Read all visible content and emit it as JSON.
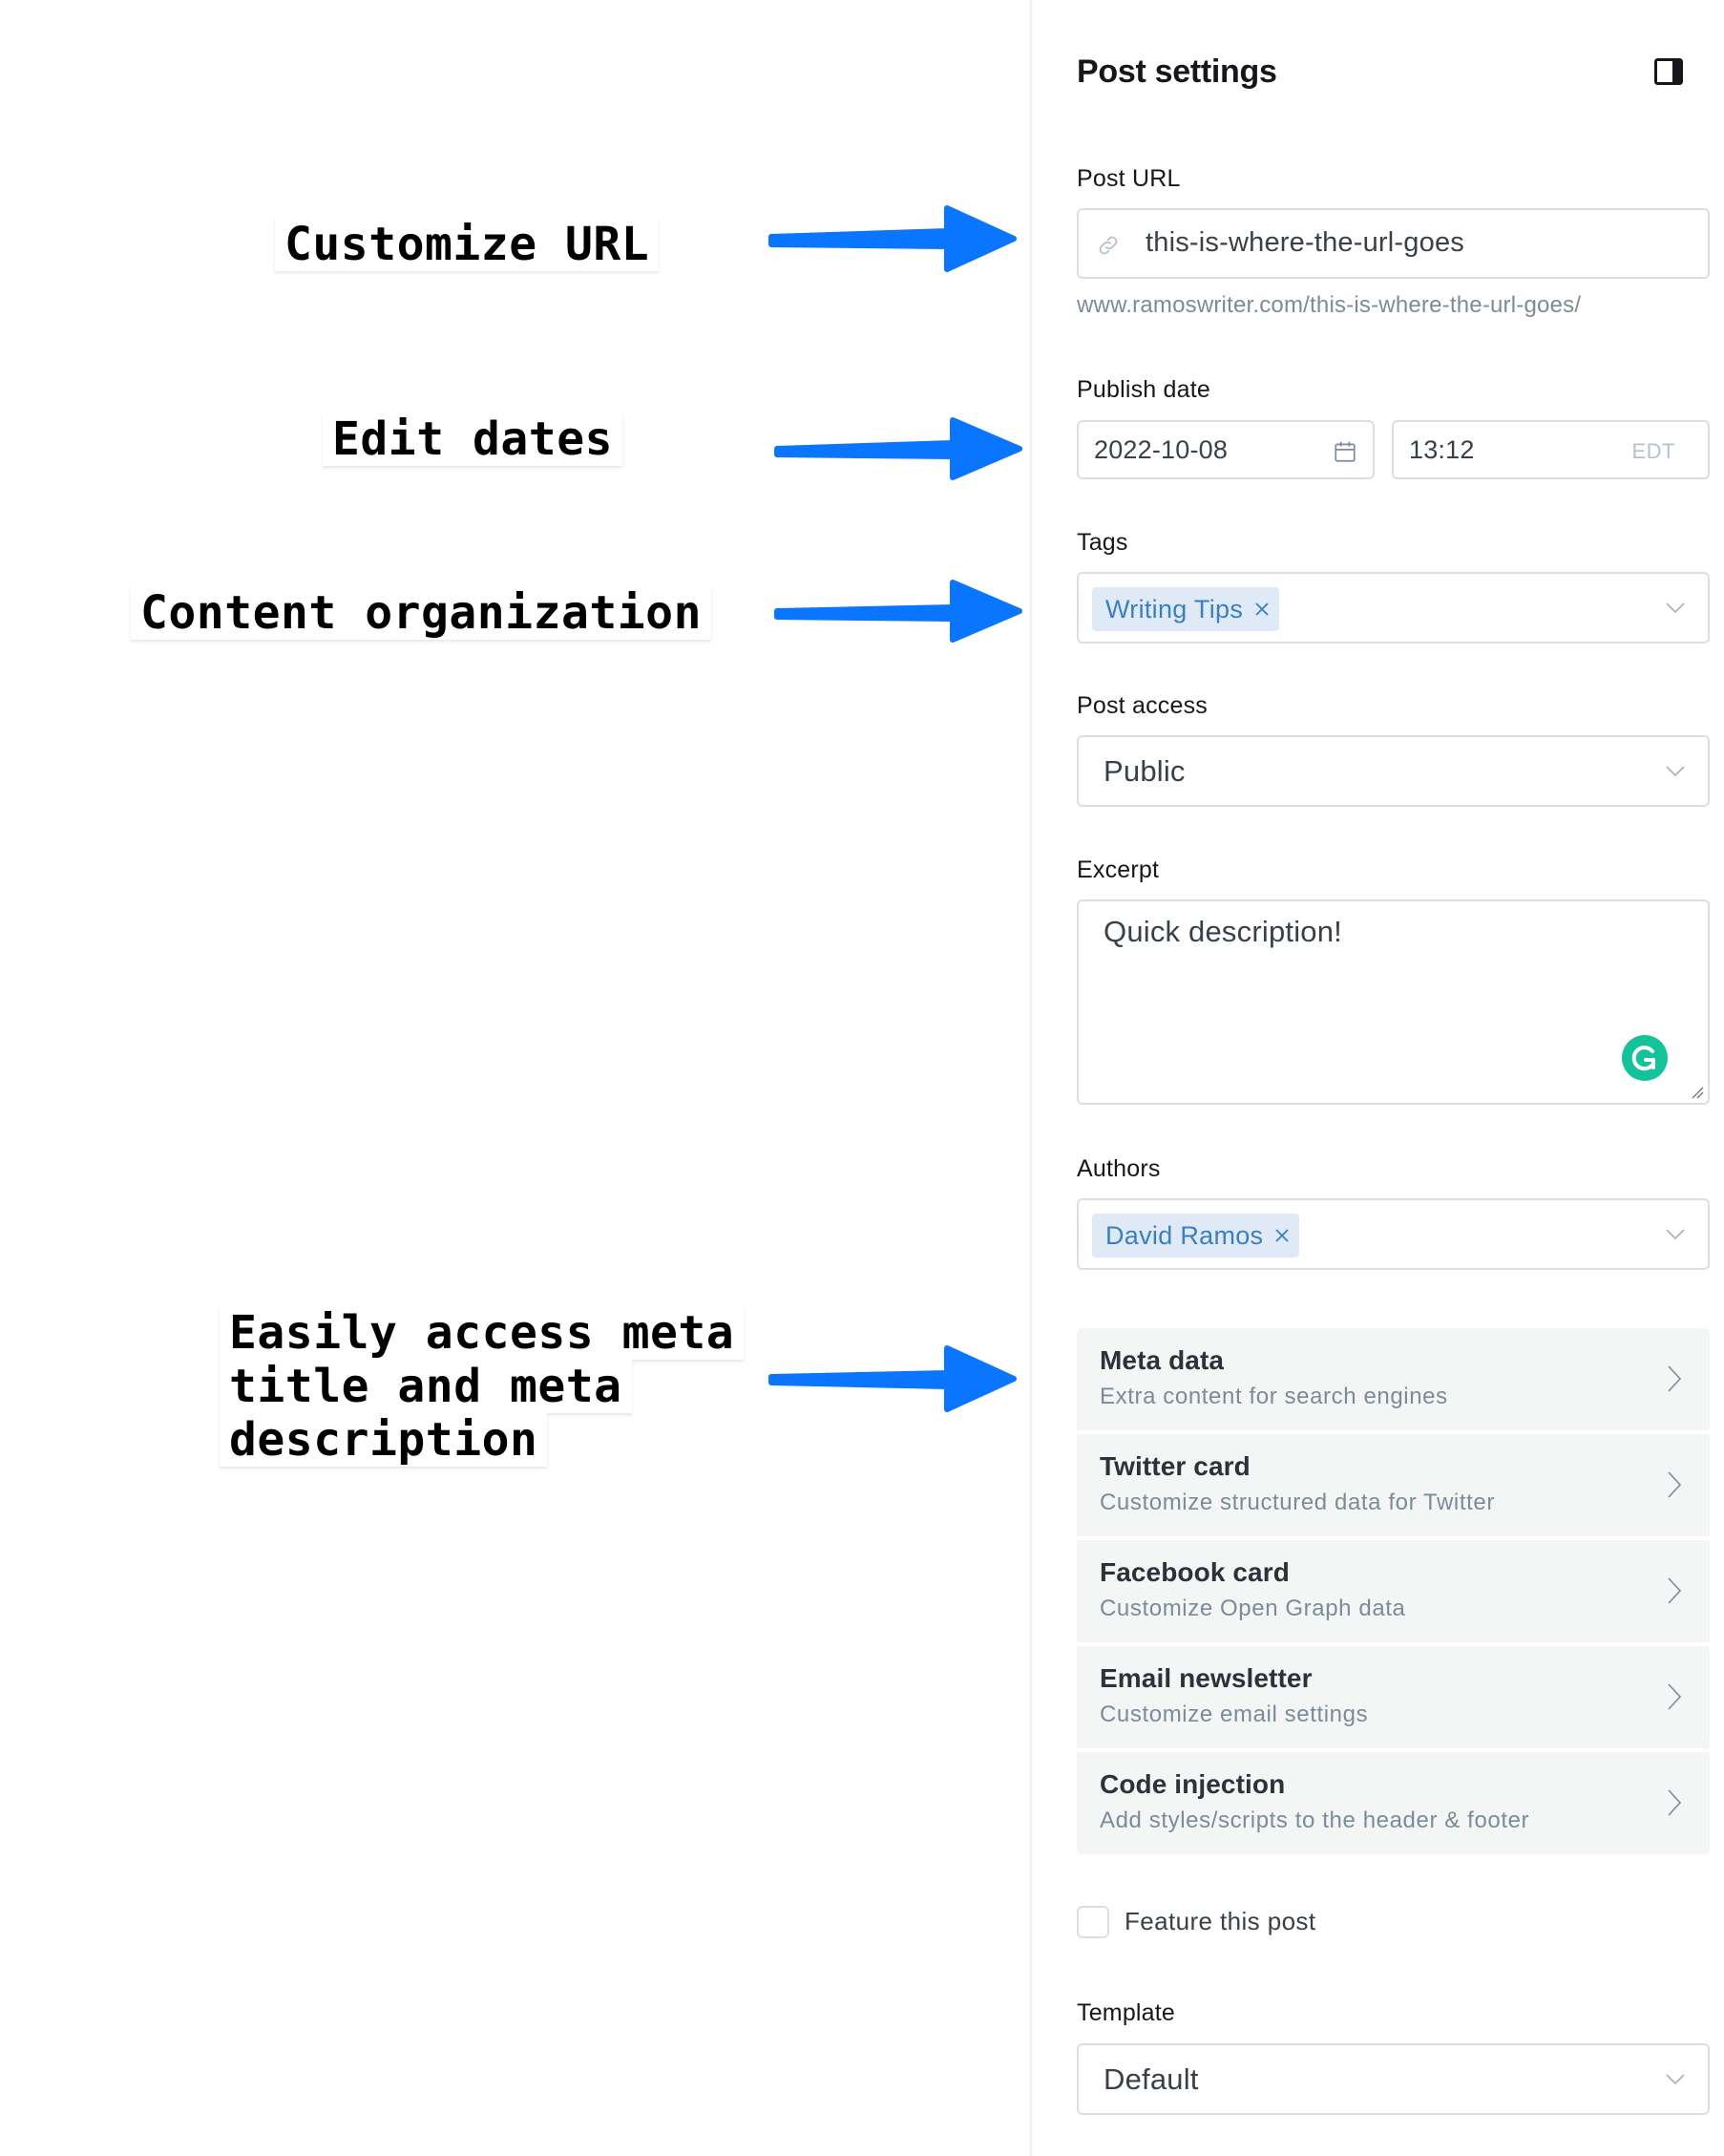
{
  "annotations": [
    {
      "id": "customize-url",
      "lines": [
        "Customize URL"
      ]
    },
    {
      "id": "edit-dates",
      "lines": [
        "Edit dates"
      ]
    },
    {
      "id": "content-organization",
      "lines": [
        "Content organization"
      ]
    },
    {
      "id": "meta-access",
      "lines": [
        "Easily access meta",
        "title and meta",
        "description"
      ]
    }
  ],
  "colors": {
    "arrow": "#0a76ff",
    "chip_bg": "#dfeaf6",
    "chip_text": "#3a7fc2",
    "grammarly": "#15c39a",
    "list_bg": "#f4f5f5"
  },
  "panel": {
    "title": "Post settings",
    "toggle_icon": "sidebar-toggle-icon",
    "post_url": {
      "label": "Post URL",
      "icon": "link-icon",
      "value": "this-is-where-the-url-goes",
      "full_url": "www.ramoswriter.com/this-is-where-the-url-goes/"
    },
    "publish_date": {
      "label": "Publish date",
      "date": "2022-10-08",
      "date_icon": "calendar-icon",
      "time": "13:12",
      "timezone": "EDT"
    },
    "tags": {
      "label": "Tags",
      "chips": [
        "Writing Tips"
      ]
    },
    "post_access": {
      "label": "Post access",
      "value": "Public"
    },
    "excerpt": {
      "label": "Excerpt",
      "value": "Quick description!"
    },
    "authors": {
      "label": "Authors",
      "chips": [
        "David Ramos"
      ]
    },
    "menu": [
      {
        "title": "Meta data",
        "subtitle": "Extra content for search engines"
      },
      {
        "title": "Twitter card",
        "subtitle": "Customize structured data for Twitter"
      },
      {
        "title": "Facebook card",
        "subtitle": "Customize Open Graph data"
      },
      {
        "title": "Email newsletter",
        "subtitle": "Customize email settings"
      },
      {
        "title": "Code injection",
        "subtitle": "Add styles/scripts to the header & footer"
      }
    ],
    "feature": {
      "label": "Feature this post",
      "checked": false
    },
    "template": {
      "label": "Template",
      "value": "Default"
    }
  }
}
